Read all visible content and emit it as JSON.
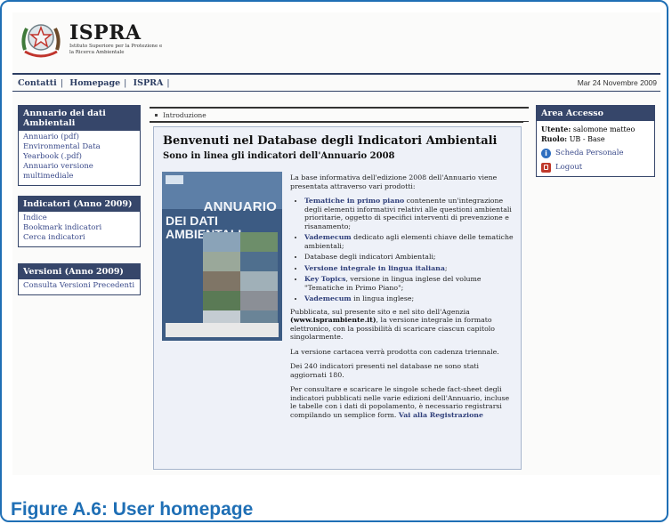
{
  "header": {
    "title": "ISPRA",
    "subtitle": "Istituto Superiore per la Protezione e la Ricerca Ambientale"
  },
  "topnav": {
    "links": [
      "Contatti",
      "Homepage",
      "ISPRA"
    ],
    "date": "Mar 24 Novembre 2009"
  },
  "sidebar": {
    "box1": {
      "title": "Annuario dei dati Ambientali",
      "items": [
        "Annuario (pdf)",
        "Environmental Data Yearbook (.pdf)",
        "Annuario versione multimediale"
      ]
    },
    "box2": {
      "title": "Indicatori (Anno 2009)",
      "items": [
        "Indice",
        "Bookmark indicatori",
        "Cerca indicatori"
      ]
    },
    "box3": {
      "title": "Versioni (Anno 2009)",
      "items": [
        "Consulta Versioni Precedenti"
      ]
    }
  },
  "breadcrumb": "Introduzione",
  "main": {
    "title": "Benvenuti nel Database degli Indicatori Ambientali",
    "subtitle": "Sono in linea gli indicatori dell'Annuario 2008",
    "cover": {
      "line1": "ANNUARIO",
      "line2": "DEI DATI AMBIENTALI"
    },
    "intro": "La base informativa dell'edizione 2008 dell'Annuario viene presentata attraverso vari prodotti:",
    "bullets": [
      {
        "strong": "Tematiche in primo piano",
        "rest": " contenente un'integrazione degli elementi informativi relativi alle questioni ambientali prioritarie, oggetto di specifici interventi di prevenzione e risanamento;"
      },
      {
        "strong": "Vademecum",
        "rest": " dedicato agli elementi chiave delle tematiche ambientali;"
      },
      {
        "strong": "",
        "rest": "Database degli indicatori Ambientali;"
      },
      {
        "strong": "Versione integrale in lingua italiana",
        "rest": ";"
      },
      {
        "strong": "Key Topics",
        "rest": ", versione in lingua inglese del volume \"Tematiche in Primo Piano\";"
      },
      {
        "strong": "Vademecum",
        "rest": " in lingua inglese;"
      }
    ],
    "para1_pre": "Pubblicata, sul presente sito e nel sito dell'Agenzia ",
    "para1_site": "(www.isprambiente.it)",
    "para1_post": ", la versione integrale in formato elettronico, con la possibilità di scaricare ciascun capitolo singolarmente.",
    "para2": "La versione cartacea verrà prodotta con cadenza triennale.",
    "para3": "Dei 240 indicatori presenti nel database ne sono stati aggiornati 180.",
    "para4": "Per consultare e scaricare le singole schede fact-sheet degli indicatori pubblicati nelle varie edizioni dell'Annuario, incluse le tabelle con i dati di popolamento, è necessario registrarsi compilando un semplice form.",
    "para4_link": "Vai alla Registrazione"
  },
  "access": {
    "title": "Area Accesso",
    "user_label": "Utente:",
    "user_value": "salomone matteo",
    "role_label": "Ruolo:",
    "role_value": "UB - Base",
    "links": [
      "Scheda Personale",
      "Logout"
    ]
  },
  "caption": "Figure A.6: User homepage",
  "colors": {
    "nav": "#2d3e63",
    "box_header": "#36466a",
    "link": "#3a4a8a",
    "caption": "#1f6fb5",
    "frame": "#1f6fb5"
  }
}
